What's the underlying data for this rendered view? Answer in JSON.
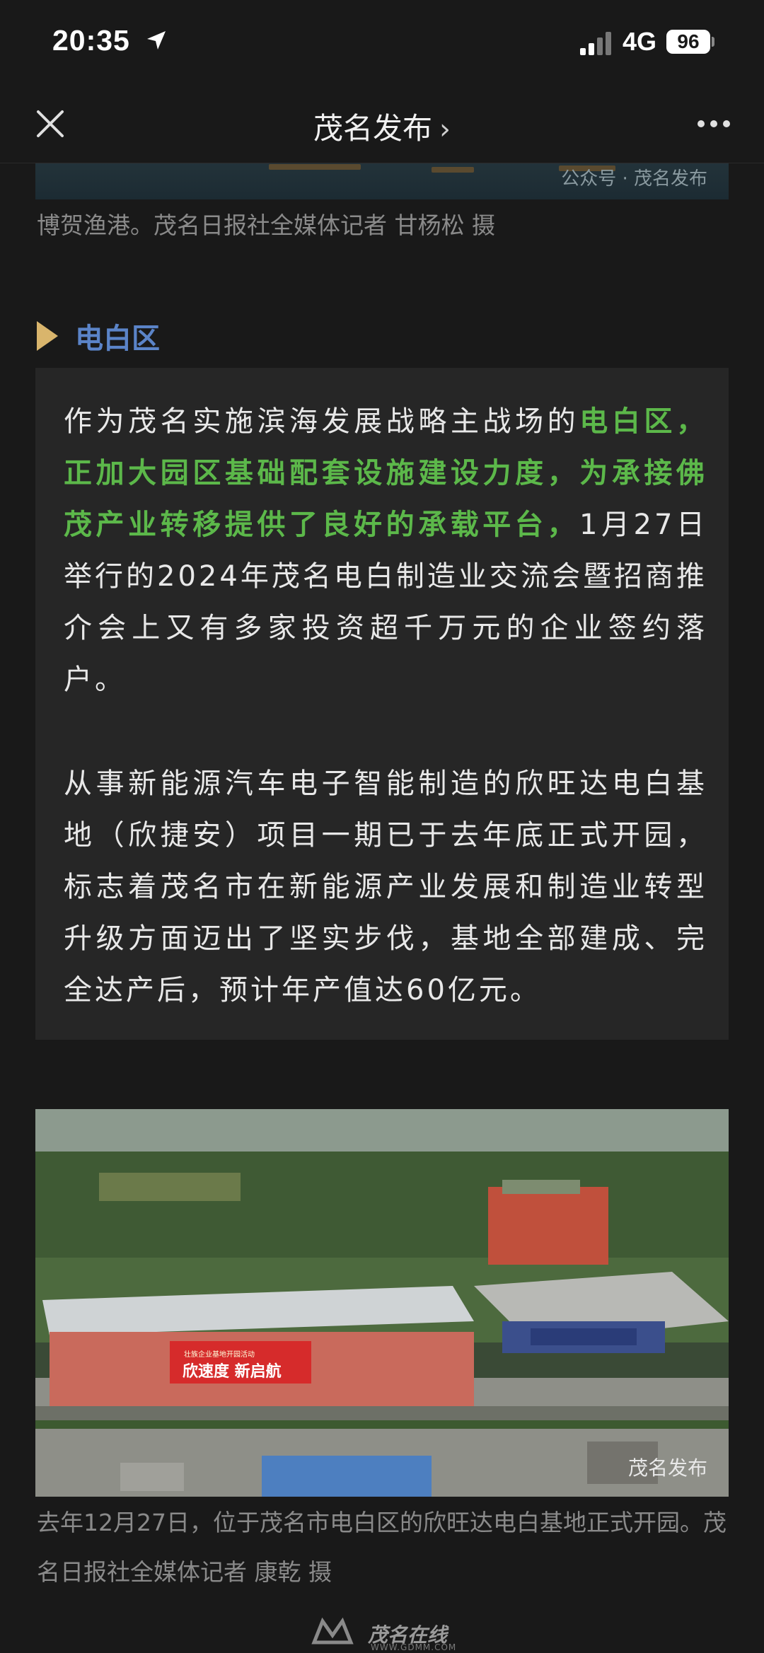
{
  "status": {
    "time": "20:35",
    "network": "4G",
    "battery": "96"
  },
  "nav": {
    "title": "茂名发布",
    "chevron": "›"
  },
  "top_image": {
    "watermark": "公众号 · 茂名发布"
  },
  "caption_1": "博贺渔港。茂名日报社全媒体记者 甘杨松 摄",
  "section": {
    "title": "电白区",
    "accent_color": "#d9b56c",
    "title_color": "#5b84c8"
  },
  "paragraph_1": {
    "lead": "作为茂名实施滨海发展战略主战场的",
    "highlight": "电白区，正加大园区基础配套设施建设力度，为承接佛茂产业转移提供了良好的承载平台，",
    "rest": "1月27日举行的2024年茂名电白制造业交流会暨招商推介会上又有多家投资超千万元的企业签约落户。"
  },
  "paragraph_2": "从事新能源汽车电子智能制造的欣旺达电白基地（欣捷安）项目一期已于去年底正式开园，标志着茂名市在新能源产业发展和制造业转型升级方面迈出了坚实步伐，基地全部建成、完全达产后，预计年产值达60亿元。",
  "photo": {
    "banner_small": "壮族企业基地开园活动",
    "banner_main": "欣速度  新启航",
    "watermark": "茂名发布"
  },
  "caption_2": "去年12月27日，位于茂名市电白区的欣旺达电白基地正式开园。茂名日报社全媒体记者 康乾 摄",
  "footer": {
    "brand": "茂名在线",
    "url": "WWW.GDMM.COM"
  },
  "colors": {
    "background": "#191919",
    "highlight_green": "#5cb84a"
  }
}
